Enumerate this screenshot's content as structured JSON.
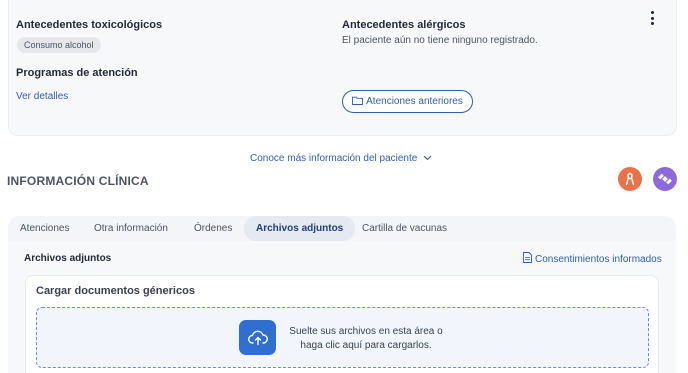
{
  "top_card": {
    "toxic_title": "Antecedentes toxicológicos",
    "toxic_chip": "Consumo alcohol",
    "programs_title": "Programas de atención",
    "programs_link": "Ver detalles",
    "allergy_title": "Antecedentes alérgicos",
    "allergy_text": "El paciente aún no tiene ninguno registrado.",
    "previous_button": "Atenciones anteriores"
  },
  "more_info": "Conoce más información del paciente",
  "section_title": "INFORMACIÓN CLÍNICA",
  "tabs": [
    {
      "label": "Atenciones",
      "active": false
    },
    {
      "label": "Otra información",
      "active": false
    },
    {
      "label": "Órdenes",
      "active": false
    },
    {
      "label": "Archivos adjuntos",
      "active": true
    },
    {
      "label": "Cartilla de vacunas",
      "active": false
    }
  ],
  "attachments": {
    "title": "Archivos adjuntos",
    "consent_link": "Consentimientos informados",
    "upload_title": "Cargar documentos génericos",
    "drop_line1": "Suelte sus archivos en esta área o",
    "drop_line2": "haga clic aquí para cargarlos."
  },
  "colors": {
    "accent": "#2f5fa8",
    "upload_button": "#2f6fd1",
    "avatar_orange": "#e8734a",
    "avatar_purple": "#8e6ad8"
  },
  "icons": [
    "kebab-menu-icon",
    "folder-icon",
    "chevron-down-icon",
    "ribbon-icon",
    "satellite-icon",
    "document-icon",
    "cloud-upload-icon"
  ]
}
